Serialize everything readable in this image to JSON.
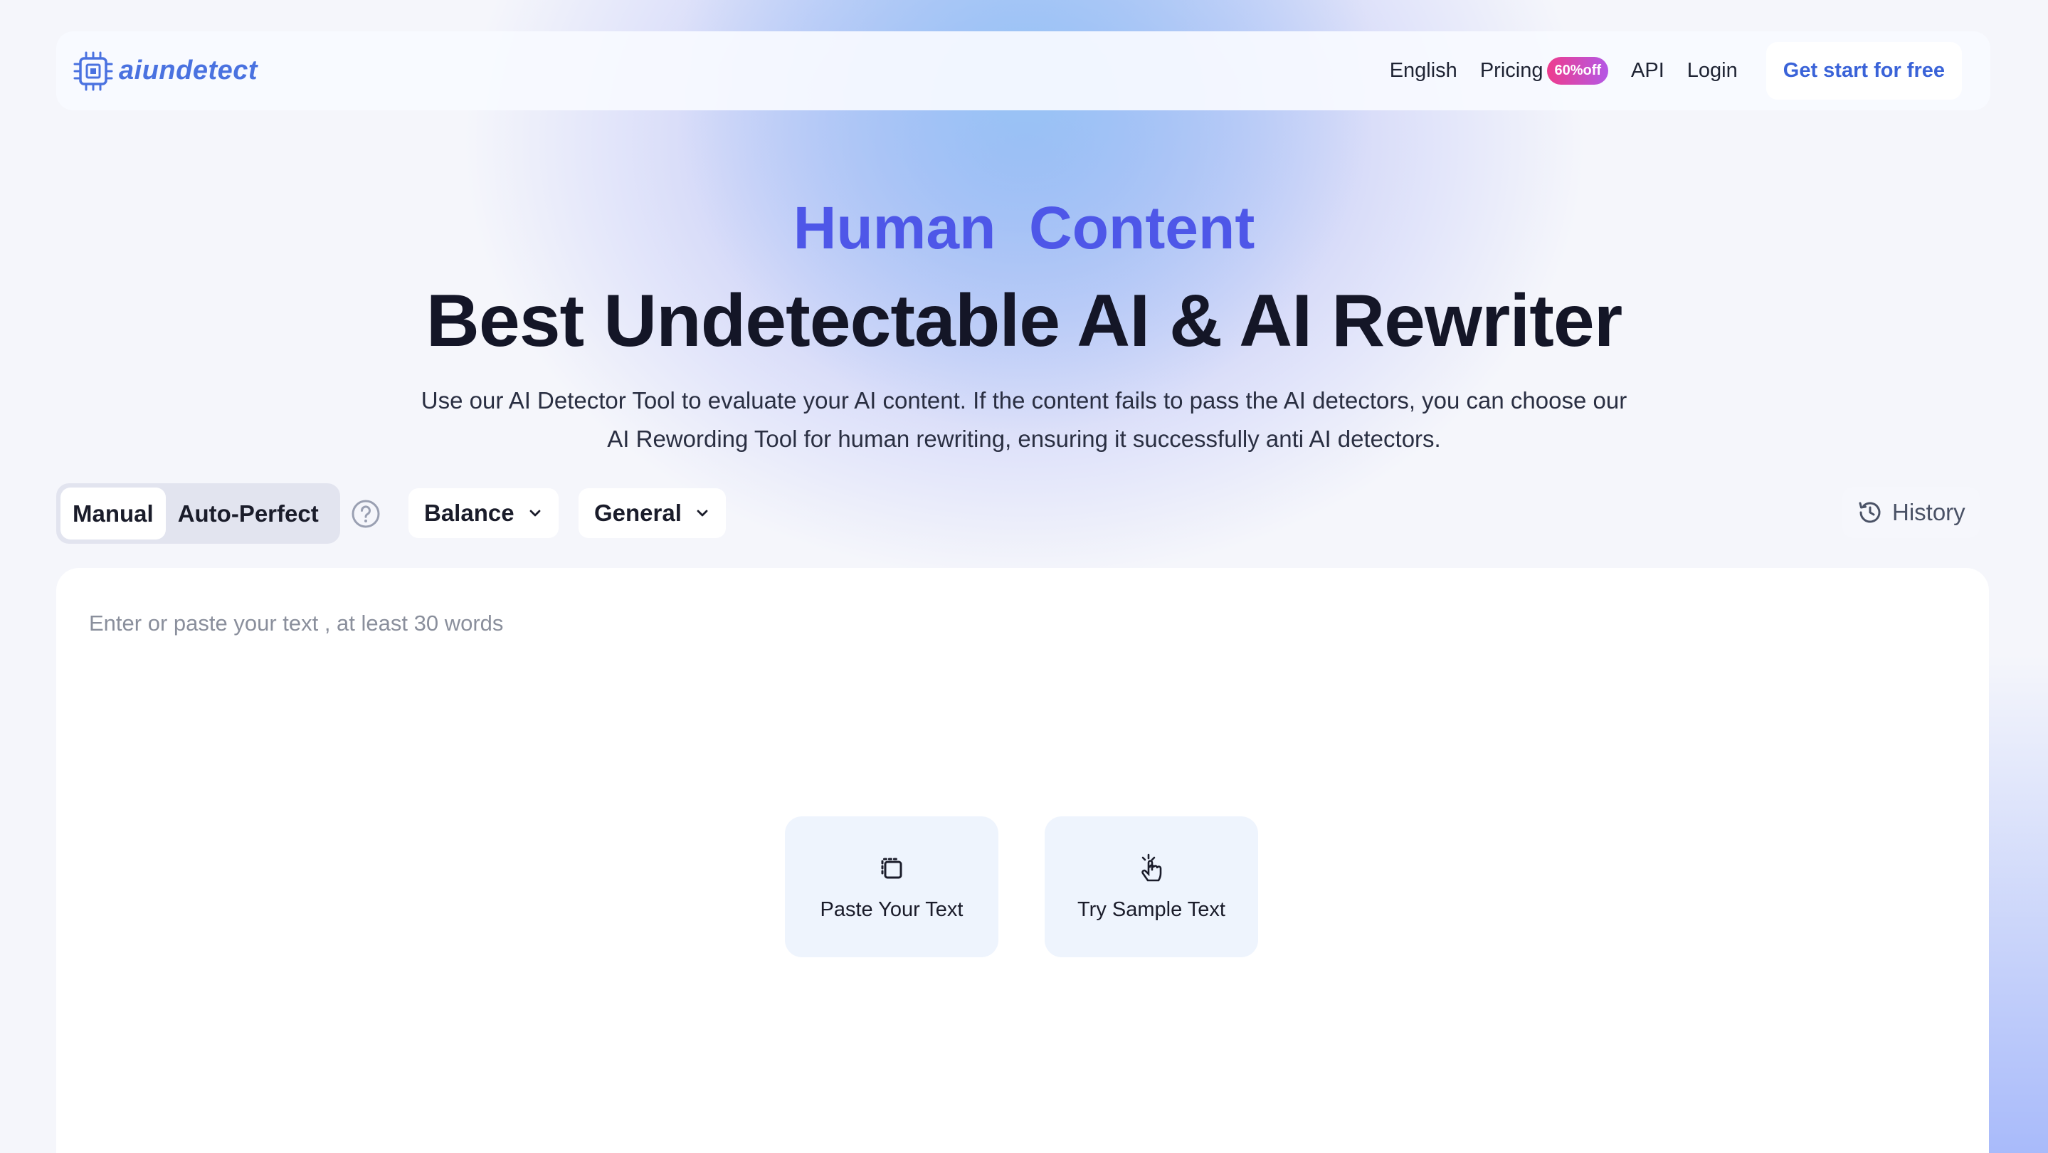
{
  "header": {
    "logo_text": "aiundetect",
    "language": "English",
    "pricing_label": "Pricing",
    "pricing_badge": "60%off",
    "api_label": "API",
    "login_label": "Login",
    "cta_label": "Get start for free"
  },
  "hero": {
    "subtitle": "Human  Content",
    "title": "Best Undetectable AI & AI Rewriter",
    "description": "Use our AI Detector Tool to evaluate your AI content. If the content fails to pass the AI detectors, you can choose our AI Rewording Tool for human rewriting, ensuring it successfully anti AI detectors."
  },
  "controls": {
    "mode_manual": "Manual",
    "mode_auto": "Auto-Perfect",
    "active_mode": "Manual",
    "strength_value": "Balance",
    "purpose_value": "General",
    "history_label": "History"
  },
  "editor": {
    "placeholder": "Enter or paste your text , at least 30 words",
    "value": "",
    "paste_label": "Paste Your Text",
    "sample_label": "Try Sample Text"
  },
  "colors": {
    "accent": "#4e57e8",
    "logo": "#4a72e0",
    "cta_text": "#3a63d8",
    "badge_start": "#ee3c8d",
    "badge_end": "#b458e6"
  },
  "icons": {
    "logo": "chip-icon",
    "help": "question-circle-icon",
    "dropdown": "chevron-down-icon",
    "history": "history-clock-icon",
    "paste": "paste-clipboard-icon",
    "sample": "tap-hand-icon"
  }
}
